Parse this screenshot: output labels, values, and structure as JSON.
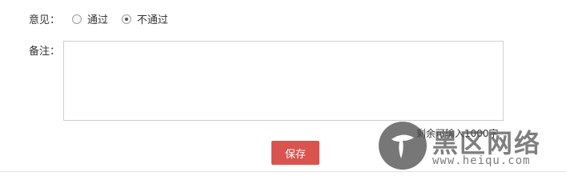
{
  "opinion": {
    "label": "意见：",
    "options": [
      {
        "label": "通过",
        "checked": false
      },
      {
        "label": "不通过",
        "checked": true
      }
    ]
  },
  "remark": {
    "label": "备注：",
    "value": "",
    "remaining_text": "剩余可输入1000字"
  },
  "actions": {
    "save_label": "保存"
  },
  "watermark": {
    "site_name": "黑区网络",
    "url": "www.heiqu.com"
  },
  "colors": {
    "save_button": "#d9534f"
  }
}
